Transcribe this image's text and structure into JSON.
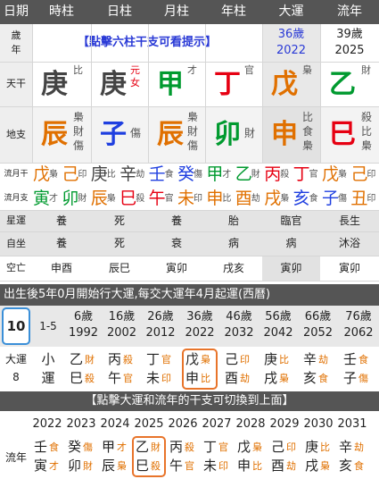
{
  "header": {
    "cols": [
      "日期",
      "時柱",
      "日柱",
      "月柱",
      "年柱",
      "大運",
      "流年"
    ]
  },
  "row_sui": {
    "label": [
      "歲",
      "年"
    ],
    "hint": "【點擊六柱干支可看提示】",
    "dayun_age": "36歲",
    "dayun_year": "2022",
    "liunian_age": "39歲",
    "liunian_year": "2025"
  },
  "tiangan": {
    "label": "天干",
    "cols": [
      {
        "char": "庚",
        "god": [
          "比"
        ]
      },
      {
        "char": "庚",
        "god": [
          "元",
          "女"
        ]
      },
      {
        "char": "甲",
        "god": [
          "才"
        ]
      },
      {
        "char": "丁",
        "god": [
          "官"
        ]
      },
      {
        "char": "戊",
        "god": [
          "梟"
        ]
      },
      {
        "char": "乙",
        "god": [
          "財"
        ]
      }
    ]
  },
  "dizhi": {
    "label": "地支",
    "cols": [
      {
        "char": "辰",
        "god": [
          "梟",
          "財",
          "傷"
        ]
      },
      {
        "char": "子",
        "god": [
          "傷"
        ]
      },
      {
        "char": "辰",
        "god": [
          "梟",
          "財",
          "傷"
        ]
      },
      {
        "char": "卯",
        "god": [
          "財"
        ]
      },
      {
        "char": "申",
        "god": [
          "比",
          "食",
          "梟"
        ]
      },
      {
        "char": "巳",
        "god": [
          "殺",
          "比",
          "梟"
        ]
      }
    ]
  },
  "liuyue": {
    "gan_label": "流月干",
    "zhi_label": "流月支",
    "gan": [
      [
        "戊",
        "梟"
      ],
      [
        "己",
        "印"
      ],
      [
        "庚",
        "比"
      ],
      [
        "辛",
        "劫"
      ],
      [
        "壬",
        "食"
      ],
      [
        "癸",
        "傷"
      ],
      [
        "甲",
        "才"
      ],
      [
        "乙",
        "財"
      ],
      [
        "丙",
        "殺"
      ],
      [
        "丁",
        "官"
      ],
      [
        "戊",
        "梟"
      ],
      [
        "己",
        "印"
      ]
    ],
    "zhi": [
      [
        "寅",
        "才"
      ],
      [
        "卯",
        "財"
      ],
      [
        "辰",
        "梟"
      ],
      [
        "巳",
        "殺"
      ],
      [
        "午",
        "官"
      ],
      [
        "未",
        "印"
      ],
      [
        "申",
        "比"
      ],
      [
        "酉",
        "劫"
      ],
      [
        "戌",
        "梟"
      ],
      [
        "亥",
        "食"
      ],
      [
        "子",
        "傷"
      ],
      [
        "丑",
        "印"
      ]
    ]
  },
  "xingyun": {
    "label": "星運",
    "values": [
      "養",
      "死",
      "養",
      "胎",
      "臨官",
      "長生"
    ]
  },
  "zizuo": {
    "label": "自坐",
    "values": [
      "養",
      "死",
      "衰",
      "病",
      "病",
      "沐浴"
    ]
  },
  "kongwang": {
    "label": "空亡",
    "values": [
      "申酉",
      "辰巳",
      "寅卯",
      "戌亥",
      "寅卯",
      "寅卯"
    ]
  },
  "dayun_info": "出生後5年0月開始行大運,每交大運年4月起運(西曆)",
  "dayun": {
    "start_age": "10",
    "range": "1-5",
    "ages": [
      [
        "6歲",
        "1992"
      ],
      [
        "16歲",
        "2002"
      ],
      [
        "26歲",
        "2012"
      ],
      [
        "36歲",
        "2022"
      ],
      [
        "46歲",
        "2032"
      ],
      [
        "56歲",
        "2042"
      ],
      [
        "66歲",
        "2052"
      ],
      [
        "76歲",
        "2062"
      ]
    ],
    "label": [
      "大運",
      "8"
    ],
    "first": [
      "小",
      "運"
    ],
    "pillars": [
      {
        "gan": "乙",
        "ggod": "財",
        "zhi": "巳",
        "zgod": "殺"
      },
      {
        "gan": "丙",
        "ggod": "殺",
        "zhi": "午",
        "zgod": "官"
      },
      {
        "gan": "丁",
        "ggod": "官",
        "zhi": "未",
        "zgod": "印"
      },
      {
        "gan": "戊",
        "ggod": "梟",
        "zhi": "申",
        "zgod": "比"
      },
      {
        "gan": "己",
        "ggod": "印",
        "zhi": "酉",
        "zgod": "劫"
      },
      {
        "gan": "庚",
        "ggod": "比",
        "zhi": "戌",
        "zgod": "梟"
      },
      {
        "gan": "辛",
        "ggod": "劫",
        "zhi": "亥",
        "zgod": "食"
      },
      {
        "gan": "壬",
        "ggod": "食",
        "zhi": "子",
        "zgod": "傷"
      }
    ]
  },
  "switch_hint": "【點擊大運和流年的干支可切換到上面】",
  "liunian": {
    "label": "流年",
    "years": [
      "2022",
      "2023",
      "2024",
      "2025",
      "2026",
      "2027",
      "2028",
      "2029",
      "2030",
      "2031"
    ],
    "pillars": [
      {
        "gan": "壬",
        "ggod": "食",
        "zhi": "寅",
        "zgod": "才"
      },
      {
        "gan": "癸",
        "ggod": "傷",
        "zhi": "卯",
        "zgod": "財"
      },
      {
        "gan": "甲",
        "ggod": "才",
        "zhi": "辰",
        "zgod": "梟"
      },
      {
        "gan": "乙",
        "ggod": "財",
        "zhi": "巳",
        "zgod": "殺"
      },
      {
        "gan": "丙",
        "ggod": "殺",
        "zhi": "午",
        "zgod": "官"
      },
      {
        "gan": "丁",
        "ggod": "官",
        "zhi": "未",
        "zgod": "印"
      },
      {
        "gan": "戊",
        "ggod": "梟",
        "zhi": "申",
        "zgod": "比"
      },
      {
        "gan": "己",
        "ggod": "印",
        "zhi": "酉",
        "zgod": "劫"
      },
      {
        "gan": "庚",
        "ggod": "比",
        "zhi": "戌",
        "zgod": "梟"
      },
      {
        "gan": "辛",
        "ggod": "劫",
        "zhi": "亥",
        "zgod": "食"
      }
    ]
  },
  "colors": {
    "fire": "#e60012",
    "wood": "#009a2f",
    "earth": "#e07000",
    "water": "#1f3fe0",
    "metal": "#444444",
    "header": "#555555",
    "highlight_blue": "#3a8fd8",
    "highlight_orange": "#e8742a"
  }
}
